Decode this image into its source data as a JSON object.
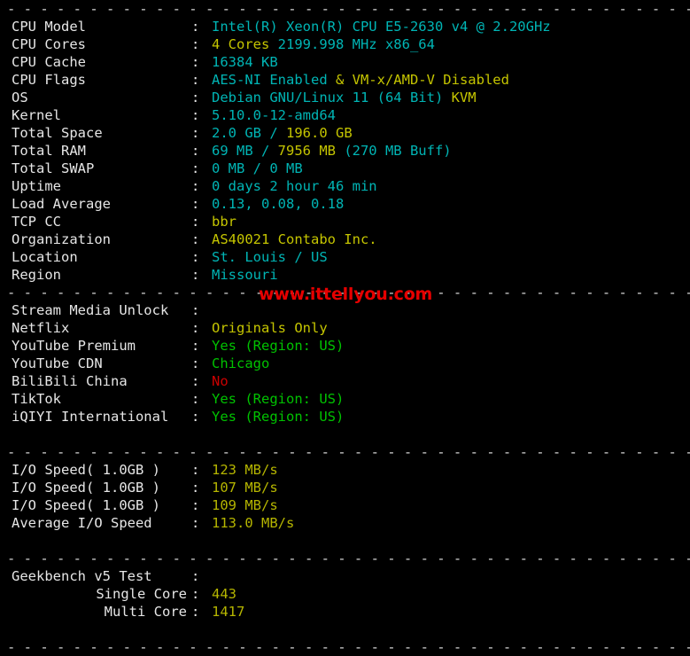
{
  "terminal": {
    "background": "#000000",
    "separator": "- - - - - - - - - - - - - - - - - - - - - - - - - - - - - - - - - - - - - - - - - - - - - -",
    "colon": ":"
  },
  "colors": {
    "cyan": "#00b5b5",
    "yellow": "#c5c500",
    "green": "#00c200",
    "red": "#cc0000",
    "olive": "#b5b500",
    "white": "#e6e6e6"
  },
  "watermark": {
    "text": "www.ittellyou.com",
    "color": "#e60000"
  },
  "system_info": [
    {
      "label": "CPU Model",
      "parts": [
        {
          "text": "Intel(R) Xeon(R) CPU E5-2630 v4 @ 2.20GHz",
          "color": "cyan"
        }
      ]
    },
    {
      "label": "CPU Cores",
      "parts": [
        {
          "text": "4 Cores ",
          "color": "yellow"
        },
        {
          "text": "2199.998 MHz x86_64",
          "color": "cyan"
        }
      ]
    },
    {
      "label": "CPU Cache",
      "parts": [
        {
          "text": "16384 KB",
          "color": "cyan"
        }
      ]
    },
    {
      "label": "CPU Flags",
      "parts": [
        {
          "text": "AES-NI Enabled ",
          "color": "cyan"
        },
        {
          "text": "& VM-x/AMD-V Disabled",
          "color": "yellow"
        }
      ]
    },
    {
      "label": "OS",
      "parts": [
        {
          "text": "Debian GNU/Linux 11 (64 Bit) ",
          "color": "cyan"
        },
        {
          "text": "KVM",
          "color": "yellow"
        }
      ]
    },
    {
      "label": "Kernel",
      "parts": [
        {
          "text": "5.10.0-12-amd64",
          "color": "cyan"
        }
      ]
    },
    {
      "label": "Total Space",
      "parts": [
        {
          "text": "2.0 GB / ",
          "color": "cyan"
        },
        {
          "text": "196.0 GB",
          "color": "yellow"
        }
      ]
    },
    {
      "label": "Total RAM",
      "parts": [
        {
          "text": "69 MB / ",
          "color": "cyan"
        },
        {
          "text": "7956 MB ",
          "color": "yellow"
        },
        {
          "text": "(270 MB Buff)",
          "color": "cyan"
        }
      ]
    },
    {
      "label": "Total SWAP",
      "parts": [
        {
          "text": "0 MB / 0 MB",
          "color": "cyan"
        }
      ]
    },
    {
      "label": "Uptime",
      "parts": [
        {
          "text": "0 days 2 hour 46 min",
          "color": "cyan"
        }
      ]
    },
    {
      "label": "Load Average",
      "parts": [
        {
          "text": "0.13, 0.08, 0.18",
          "color": "cyan"
        }
      ]
    },
    {
      "label": "TCP CC",
      "parts": [
        {
          "text": "bbr",
          "color": "yellow"
        }
      ]
    },
    {
      "label": "Organization",
      "parts": [
        {
          "text": "AS40021 Contabo Inc.",
          "color": "yellow"
        }
      ]
    },
    {
      "label": "Location",
      "parts": [
        {
          "text": "St. Louis / US",
          "color": "cyan"
        }
      ]
    },
    {
      "label": "Region",
      "parts": [
        {
          "text": "Missouri",
          "color": "cyan"
        }
      ]
    }
  ],
  "stream_media": [
    {
      "label": "Stream Media Unlock",
      "parts": []
    },
    {
      "label": "Netflix",
      "parts": [
        {
          "text": "Originals Only",
          "color": "yellow"
        }
      ]
    },
    {
      "label": "YouTube Premium",
      "parts": [
        {
          "text": "Yes (Region: US)",
          "color": "green"
        }
      ]
    },
    {
      "label": "YouTube CDN",
      "parts": [
        {
          "text": "Chicago",
          "color": "green"
        }
      ]
    },
    {
      "label": "BiliBili China",
      "parts": [
        {
          "text": "No",
          "color": "red"
        }
      ]
    },
    {
      "label": "TikTok",
      "parts": [
        {
          "text": "Yes (Region: US)",
          "color": "green"
        }
      ]
    },
    {
      "label": "iQIYI International",
      "parts": [
        {
          "text": "Yes (Region: US)",
          "color": "green"
        }
      ]
    }
  ],
  "io_speed": [
    {
      "label": "I/O Speed( 1.0GB )",
      "parts": [
        {
          "text": "123 MB/s",
          "color": "olive"
        }
      ]
    },
    {
      "label": "I/O Speed( 1.0GB )",
      "parts": [
        {
          "text": "107 MB/s",
          "color": "olive"
        }
      ]
    },
    {
      "label": "I/O Speed( 1.0GB )",
      "parts": [
        {
          "text": "109 MB/s",
          "color": "olive"
        }
      ]
    },
    {
      "label": "Average I/O Speed",
      "parts": [
        {
          "text": "113.0 MB/s",
          "color": "olive"
        }
      ]
    }
  ],
  "geekbench": [
    {
      "label": "Geekbench v5 Test",
      "indent": false,
      "parts": []
    },
    {
      "label": "Single Core",
      "indent": true,
      "parts": [
        {
          "text": "443",
          "color": "olive"
        }
      ]
    },
    {
      "label": "Multi Core",
      "indent": true,
      "parts": [
        {
          "text": "1417",
          "color": "olive"
        }
      ]
    }
  ]
}
